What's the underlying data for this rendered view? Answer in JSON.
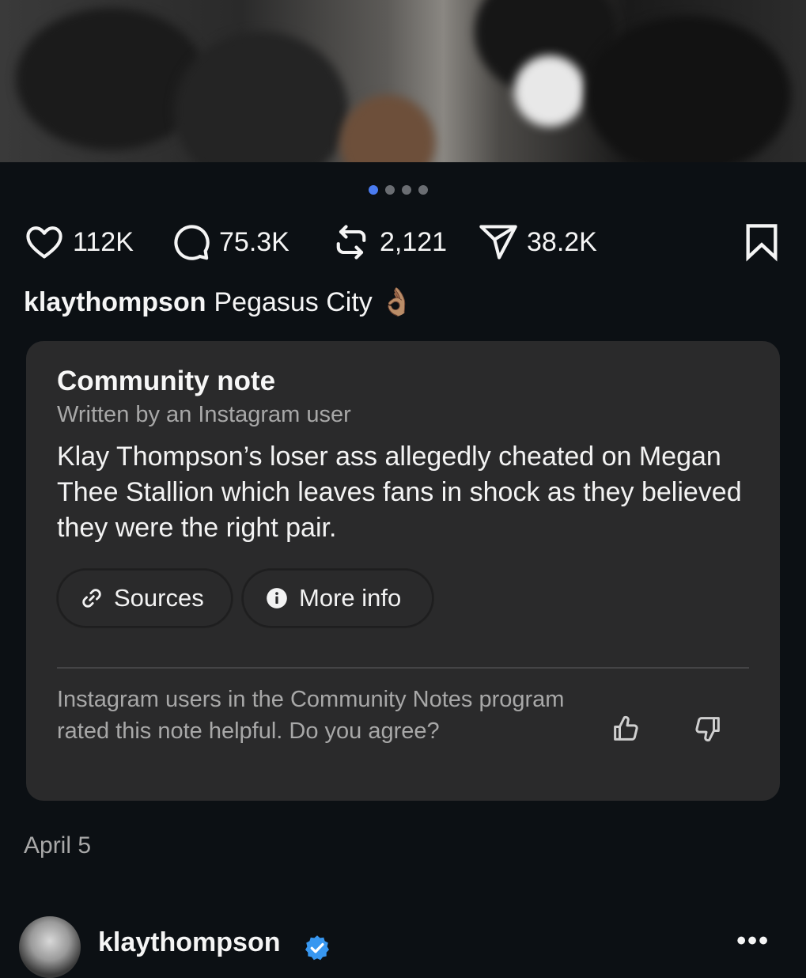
{
  "post": {
    "likes": "112K",
    "comments": "75.3K",
    "reposts": "2,121",
    "shares": "38.2K",
    "username": "klaythompson",
    "caption": "Pegasus City",
    "caption_emoji": "👌🏽",
    "date": "April 5",
    "carousel_count": 4,
    "carousel_active": 1
  },
  "community_note": {
    "title": "Community note",
    "byline": "Written by an Instagram user",
    "body": "Klay Thompson’s loser ass allegedly cheated on Megan Thee Stallion which leaves fans in shock as they believed they were the right pair.",
    "sources_label": "Sources",
    "more_info_label": "More info",
    "rated_text": "Instagram users in the Community Notes program rated this note helpful. Do you agree?"
  },
  "next_post": {
    "username": "klaythompson",
    "more_label": "•••"
  },
  "colors": {
    "background": "#0c1014",
    "note_card": "#2a2a2b",
    "accent_dot": "#4a7bf0",
    "verified": "#3897f0"
  },
  "icons": [
    "heart-icon",
    "comment-icon",
    "repost-icon",
    "share-icon",
    "bookmark-icon",
    "link-icon",
    "info-icon",
    "thumbs-up-icon",
    "thumbs-down-icon",
    "verified-badge-icon",
    "more-icon"
  ]
}
